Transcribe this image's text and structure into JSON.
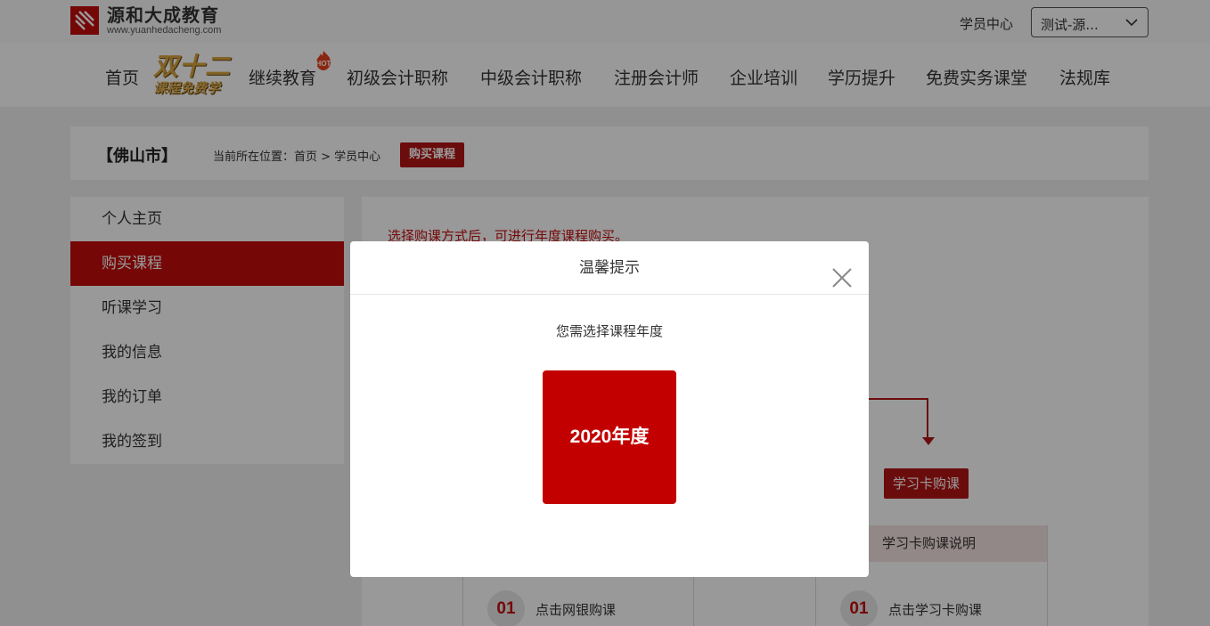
{
  "header": {
    "logo_cn": "源和大成教育",
    "logo_en": "www.yuanhedacheng.com",
    "student_center": "学员中心",
    "user_select": "测试-源...",
    "brand_color": "#c30d0d"
  },
  "nav": {
    "home": "首页",
    "promo_top": "双十二",
    "promo_bottom": "课程免费学",
    "continuing_edu": "继续教育",
    "hot_badge": "HOT",
    "junior_accountant": "初级会计职称",
    "intermediate_accountant": "中级会计职称",
    "cpa": "注册会计师",
    "enterprise_training": "企业培训",
    "degree": "学历提升",
    "free_practice": "免费实务课堂",
    "regulations": "法规库"
  },
  "breadcrumb": {
    "city": "【佛山市】",
    "label": "当前所在位置：首页 > 学员中心",
    "current": "购买课程"
  },
  "sidebar": {
    "items": [
      {
        "label": "个人主页"
      },
      {
        "label": "购买课程",
        "active": true
      },
      {
        "label": "听课学习"
      },
      {
        "label": "我的信息"
      },
      {
        "label": "我的订单"
      },
      {
        "label": "我的签到"
      }
    ]
  },
  "main": {
    "hint": "选择购课方式后，可进行年度课程购买。",
    "card_button": "学习卡购课",
    "card_explain": "学习卡购课说明",
    "step_left_num": "01",
    "step_left_text": "点击网银购课",
    "step_right_num": "01",
    "step_right_text": "点击学习卡购课"
  },
  "modal": {
    "title": "温馨提示",
    "message": "您需选择课程年度",
    "year_button": "2020年度",
    "year_color": "#c30000"
  }
}
